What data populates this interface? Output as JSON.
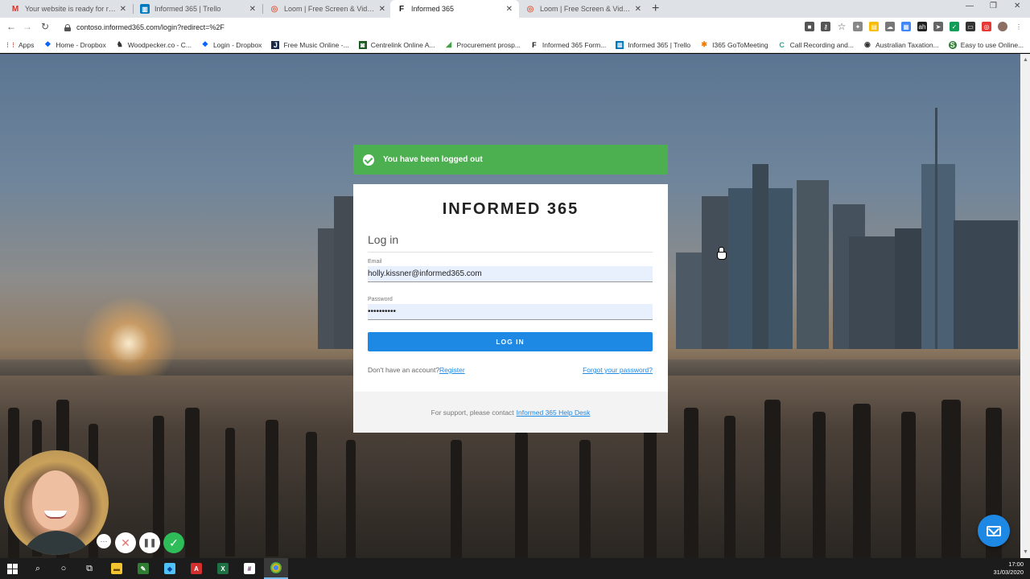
{
  "browser": {
    "tabs": [
      {
        "title": "Your website is ready for review!",
        "icon": "gmail-icon",
        "color": "#d93025",
        "glyph": "M",
        "active": false
      },
      {
        "title": "Informed 365 | Trello",
        "icon": "trello-icon",
        "color": "#0079bf",
        "glyph": "▣",
        "active": false
      },
      {
        "title": "Loom | Free Screen & Video Rec",
        "icon": "loom-icon",
        "color": "#e2654d",
        "glyph": "◎",
        "active": false
      },
      {
        "title": "Informed 365",
        "icon": "informed365-icon",
        "color": "#111111",
        "glyph": "F",
        "active": true
      },
      {
        "title": "Loom | Free Screen & Video Rec",
        "icon": "loom-icon",
        "color": "#e2654d",
        "glyph": "◎",
        "active": false
      }
    ],
    "url": "contoso.informed365.com/login?redirect=%2F",
    "bookmarks": [
      {
        "label": "Apps",
        "icon": "apps-grid-icon",
        "color": "#c0392b",
        "glyph": "⋮⋮"
      },
      {
        "label": "Home - Dropbox",
        "icon": "dropbox-icon",
        "color": "#0061ff",
        "glyph": "❖"
      },
      {
        "label": "Woodpecker.co - C...",
        "icon": "woodpecker-icon",
        "color": "#333333",
        "glyph": "♞"
      },
      {
        "label": "Login - Dropbox",
        "icon": "dropbox-icon",
        "color": "#0061ff",
        "glyph": "❖"
      },
      {
        "label": "Free Music Online -...",
        "icon": "jamendo-icon",
        "color": "#1a2a4a",
        "glyph": "J"
      },
      {
        "label": "Centrelink Online A...",
        "icon": "centrelink-icon",
        "color": "#1b5e20",
        "glyph": "◙"
      },
      {
        "label": "Procurement prosp...",
        "icon": "procurement-icon",
        "color": "#43a047",
        "glyph": "◢"
      },
      {
        "label": "Informed 365 Form...",
        "icon": "informed365-icon",
        "color": "#111111",
        "glyph": "F"
      },
      {
        "label": "Informed 365 | Trello",
        "icon": "trello-icon",
        "color": "#0079bf",
        "glyph": "▣"
      },
      {
        "label": "I365 GoToMeeting",
        "icon": "gotomeeting-icon",
        "color": "#f57c00",
        "glyph": "✱"
      },
      {
        "label": "Call Recording and...",
        "icon": "call-recording-icon",
        "color": "#26a69a",
        "glyph": "C"
      },
      {
        "label": "Australian Taxation...",
        "icon": "ato-icon",
        "color": "#333333",
        "glyph": "◉"
      },
      {
        "label": "Easy to use Online...",
        "icon": "online-tool-icon",
        "color": "#2e7d32",
        "glyph": "S"
      }
    ]
  },
  "alert": {
    "message": "You have been logged out",
    "color": "#4caf50"
  },
  "login": {
    "logo": "INFORMED 365",
    "heading": "Log in",
    "email_label": "Email",
    "email_value": "holly.kissner@informed365.com",
    "password_label": "Password",
    "password_value": "••••••••••",
    "submit_label": "LOG IN",
    "no_account_text": "Don't have an account?",
    "register_link": "Register",
    "forgot_link": "Forgot your password?",
    "support_text": "For support, please contact",
    "support_link": "Informed 365 Help Desk",
    "accent_color": "#1e88e5"
  },
  "taskbar": {
    "time": "17:00",
    "date": "31/03/2020"
  }
}
